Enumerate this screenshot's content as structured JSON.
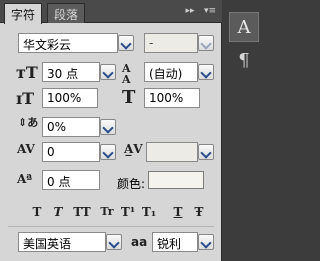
{
  "tabs": [
    {
      "label": "字符"
    },
    {
      "label": "段落"
    }
  ],
  "header": {
    "collapse_icon": "double-arrow-icon",
    "menu_icon": "panel-menu-icon"
  },
  "font": {
    "family": "华文彩云",
    "style": "-"
  },
  "size": {
    "font_size": "30 点",
    "leading": "(自动)"
  },
  "scale": {
    "vertical": "100%",
    "horizontal": "100%"
  },
  "baseline": {
    "shift": "0%"
  },
  "kerning": {
    "value": "0",
    "tracking": ""
  },
  "tsume": {
    "value": "0 点"
  },
  "color": {
    "label": "颜色:",
    "value": "#f4f3ee"
  },
  "styles": [
    "T",
    "T",
    "TT",
    "Tr",
    "T¹",
    "T₁",
    "T",
    "Ŧ"
  ],
  "bottom": {
    "language": "美国英语",
    "aa_icon": "aa",
    "antialias": "锐利"
  },
  "dock": {
    "char_icon": "A",
    "para_icon": "¶"
  }
}
